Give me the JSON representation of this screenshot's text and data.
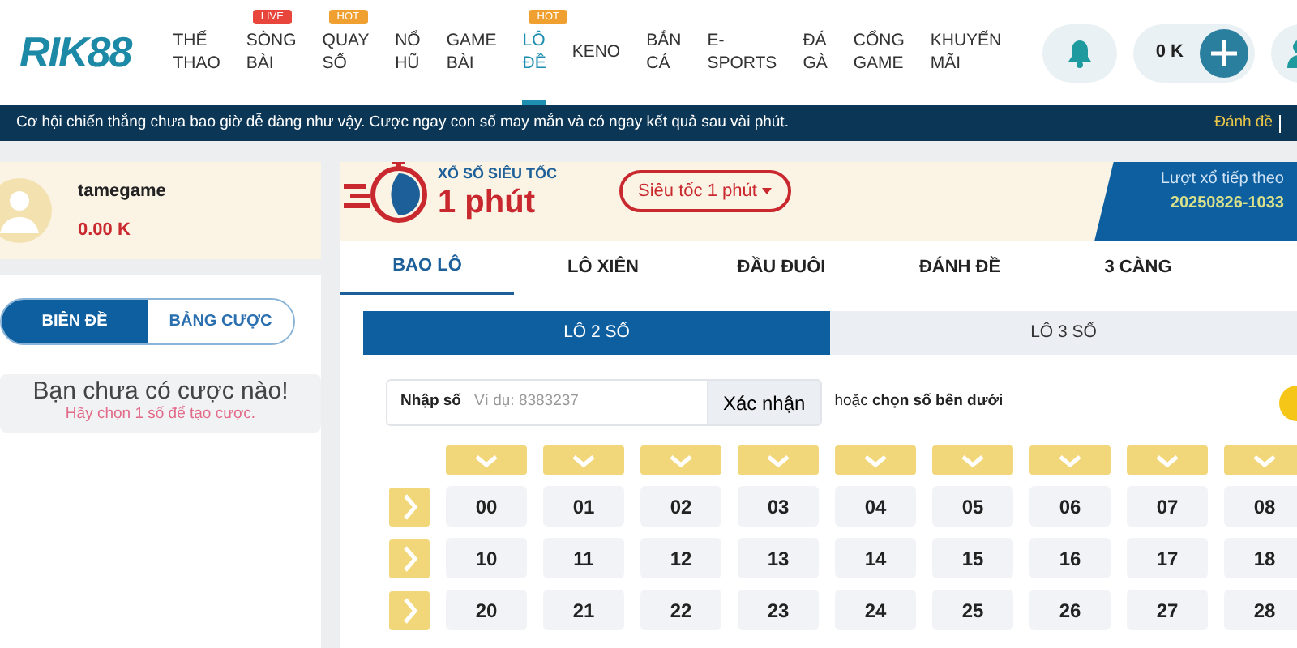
{
  "header": {
    "logo": "RIK88",
    "nav": [
      {
        "label": "THẾ THAO",
        "selected": false
      },
      {
        "label": "SÒNG BÀI",
        "selected": false,
        "badge": {
          "text": "LIVE",
          "color": "#e8463c"
        }
      },
      {
        "label": "QUAY SỐ",
        "selected": false,
        "badge": {
          "text": "HOT",
          "color": "#f0a030"
        }
      },
      {
        "label": "NỔ HŨ",
        "selected": false
      },
      {
        "label": "GAME BÀI",
        "selected": false
      },
      {
        "label": "LÔ ĐỀ",
        "selected": true,
        "badge": {
          "text": "HOT",
          "color": "#f0a030"
        }
      },
      {
        "label": "KENO",
        "selected": false
      },
      {
        "label": "BẮN CÁ",
        "selected": false
      },
      {
        "label": "E-SPORTS",
        "selected": false
      },
      {
        "label": "ĐÁ GÀ",
        "selected": false
      },
      {
        "label": "CỔNG GAME",
        "selected": false
      },
      {
        "label": "KHUYẾN MÃI",
        "selected": false
      }
    ],
    "balance": "0 K"
  },
  "ticker": {
    "message": "Cơ hội chiến thắng chưa bao giờ dễ dàng như vậy. Cược ngay con số may mắn và có ngay kết quả sau vài phút.",
    "link": "Đánh đề"
  },
  "user": {
    "name": "tamegame",
    "balance": "0.00 K"
  },
  "bet_tabs": [
    {
      "label": "BIÊN ĐỀ",
      "selected": true
    },
    {
      "label": "BẢNG CƯỢC",
      "selected": false
    }
  ],
  "empty_state": {
    "title": "Bạn chưa có cược nào!",
    "hint": "Hãy chọn 1 số để tạo cược."
  },
  "game": {
    "subtitle": "XỔ SỐ SIÊU TỐC",
    "title": "1 phút",
    "mode": "Siêu tốc 1 phút",
    "next_draw_label": "Lượt xổ tiếp theo",
    "next_draw_id": "20250826-1033"
  },
  "bet_types": [
    {
      "label": "BAO LÔ",
      "selected": true
    },
    {
      "label": "LÔ XIÊN",
      "selected": false
    },
    {
      "label": "ĐẦU ĐUÔI",
      "selected": false
    },
    {
      "label": "ĐÁNH ĐỀ",
      "selected": false
    },
    {
      "label": "3 CÀNG",
      "selected": false
    }
  ],
  "digit_tabs": [
    {
      "label": "LÔ 2 SỐ",
      "selected": true
    },
    {
      "label": "LÔ 3 SỐ",
      "selected": false
    }
  ],
  "number_input": {
    "label": "Nhập số",
    "placeholder": "Ví dụ: 8383237",
    "button": "Xác nhận",
    "hint": "hoặc **chọn số bên dưới**"
  },
  "number_grid": [
    [
      "00",
      "01",
      "02",
      "03",
      "04",
      "05",
      "06",
      "07",
      "08"
    ],
    [
      "10",
      "11",
      "12",
      "13",
      "14",
      "15",
      "16",
      "17",
      "18"
    ],
    [
      "20",
      "21",
      "22",
      "23",
      "24",
      "25",
      "26",
      "27",
      "28"
    ]
  ]
}
